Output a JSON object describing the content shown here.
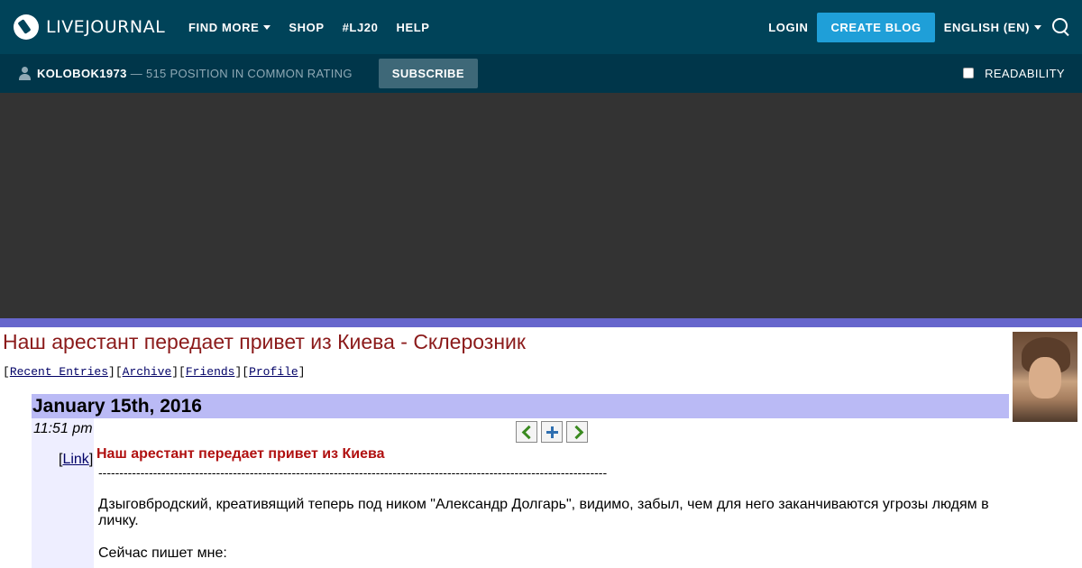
{
  "topbar": {
    "logo_text": "LIVEJOURNAL",
    "nav": [
      "FIND MORE",
      "SHOP",
      "#LJ20",
      "HELP"
    ],
    "login": "LOGIN",
    "create_blog": "CREATE BLOG",
    "language": "ENGLISH (EN)",
    "colors": {
      "bg": "#004359",
      "accent": "#1f9fd8"
    }
  },
  "userbar": {
    "username": "KOLOBOK1973",
    "rating": "— 515 POSITION IN COMMON RATING",
    "subscribe": "SUBSCRIBE",
    "readability": "READABILITY"
  },
  "journal": {
    "title": "Наш арестант передает привет из Киева - Склерозник",
    "links": {
      "recent": "Recent Entries",
      "archive": "Archive",
      "friends": "Friends",
      "profile": "Profile"
    },
    "date": "January 15th, 2016",
    "time": "11:51 pm",
    "link_label": "Link",
    "entry": {
      "subject": "Наш арестант передает привет из Киева",
      "separator": "-------------------------------------------------------------------------------------------------------------------------",
      "paragraph1": "Дзыговбродский,   креативящий теперь под ником \"Александр Долгарь\",  видимо, забыл, чем для него заканчиваются угрозы  людям в личку.",
      "paragraph2": "Сейчас пишет мне:"
    }
  }
}
